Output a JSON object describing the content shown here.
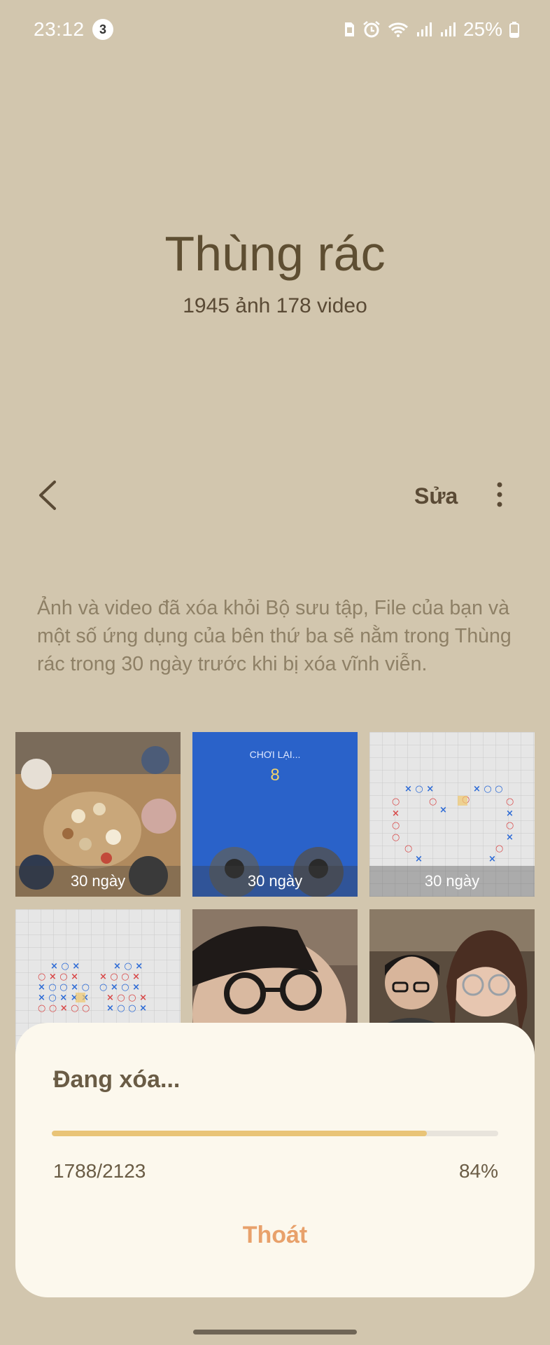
{
  "status_bar": {
    "time": "23:12",
    "notification_count": "3",
    "battery": "25%"
  },
  "header": {
    "title": "Thùng rác",
    "subtitle": "1945 ảnh 178 video"
  },
  "toolbar": {
    "edit_label": "Sửa"
  },
  "info_text": "Ảnh và video đã xóa khỏi Bộ sưu tập, File của bạn và một số ứng dụng của bên thứ ba sẽ nằm trong Thùng rác trong 30 ngày trước khi bị xóa vĩnh viễn.",
  "grid": {
    "items": [
      {
        "days": "30 ngày"
      },
      {
        "days": "30 ngày",
        "overlay_title": "CHƠI LẠI...",
        "overlay_count": "8"
      },
      {
        "days": "30 ngày"
      },
      {
        "days": ""
      },
      {
        "days": ""
      },
      {
        "days": ""
      }
    ]
  },
  "dialog": {
    "title": "Đang xóa...",
    "progress_value": 0.84,
    "count_text": "1788/2123",
    "percent_text": "84%",
    "exit_label": "Thoát"
  },
  "colors": {
    "background": "#d2c6ae",
    "accent": "#e8a16b",
    "progress": "#e9c477"
  }
}
